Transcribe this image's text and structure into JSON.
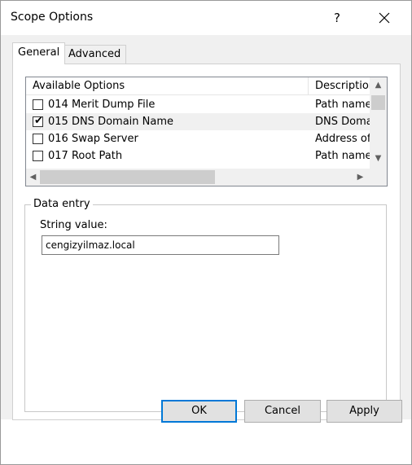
{
  "window": {
    "title": "Scope Options",
    "help_label": "?",
    "close_label": "×"
  },
  "tabs": {
    "general": "General",
    "advanced": "Advanced"
  },
  "options_list": {
    "headers": [
      "Available Options",
      "Description"
    ],
    "rows": [
      {
        "checked": false,
        "name": "014 Merit Dump File",
        "description": "Path name"
      },
      {
        "checked": true,
        "name": "015 DNS Domain Name",
        "description": "DNS Domain"
      },
      {
        "checked": false,
        "name": "016 Swap Server",
        "description": "Address of"
      },
      {
        "checked": false,
        "name": "017 Root Path",
        "description": "Path name"
      }
    ]
  },
  "data_entry": {
    "group_label": "Data entry",
    "string_label": "String value:",
    "string_value": "cengizyilmaz.local"
  },
  "buttons": {
    "ok": "OK",
    "cancel": "Cancel",
    "apply": "Apply"
  }
}
